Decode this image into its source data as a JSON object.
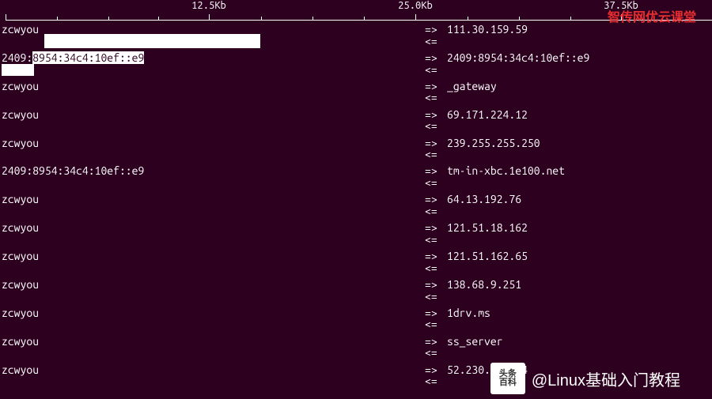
{
  "scale": {
    "ticks": [
      {
        "label": "12.5Kb",
        "pos": 264
      },
      {
        "label": "25.0Kb",
        "pos": 525
      },
      {
        "label": "37.5Kb",
        "pos": 785
      }
    ]
  },
  "watermarks": {
    "top": "智传网优云课堂",
    "bottom_badge_l1": "头条",
    "bottom_badge_l2": "百科",
    "bottom_text": "@Linux基础入门教程"
  },
  "arrows": {
    "out": "=>",
    "in": "<="
  },
  "rows": [
    {
      "src": "zcwyou",
      "dest": "111.30.159.59",
      "redact_after1": true
    },
    {
      "src": "2409:8954:34c4:10ef::e9",
      "dest": "2409:8954:34c4:10ef::e9",
      "highlight_src": true,
      "redact_after2": true
    },
    {
      "src": "zcwyou",
      "dest": "_gateway"
    },
    {
      "src": "zcwyou",
      "dest": "69.171.224.12"
    },
    {
      "src": "zcwyou",
      "dest": "239.255.255.250"
    },
    {
      "src": "2409:8954:34c4:10ef::e9",
      "dest": "tm-in-xbc.1e100.net"
    },
    {
      "src": "zcwyou",
      "dest": "64.13.192.76"
    },
    {
      "src": "zcwyou",
      "dest": "121.51.18.162"
    },
    {
      "src": "zcwyou",
      "dest": "121.51.162.65"
    },
    {
      "src": "zcwyou",
      "dest": "138.68.9.251"
    },
    {
      "src": "zcwyou",
      "dest": "1drv.ms"
    },
    {
      "src": "zcwyou",
      "dest": "ss_server"
    },
    {
      "src": "zcwyou",
      "dest": "52.230.84.104"
    }
  ]
}
